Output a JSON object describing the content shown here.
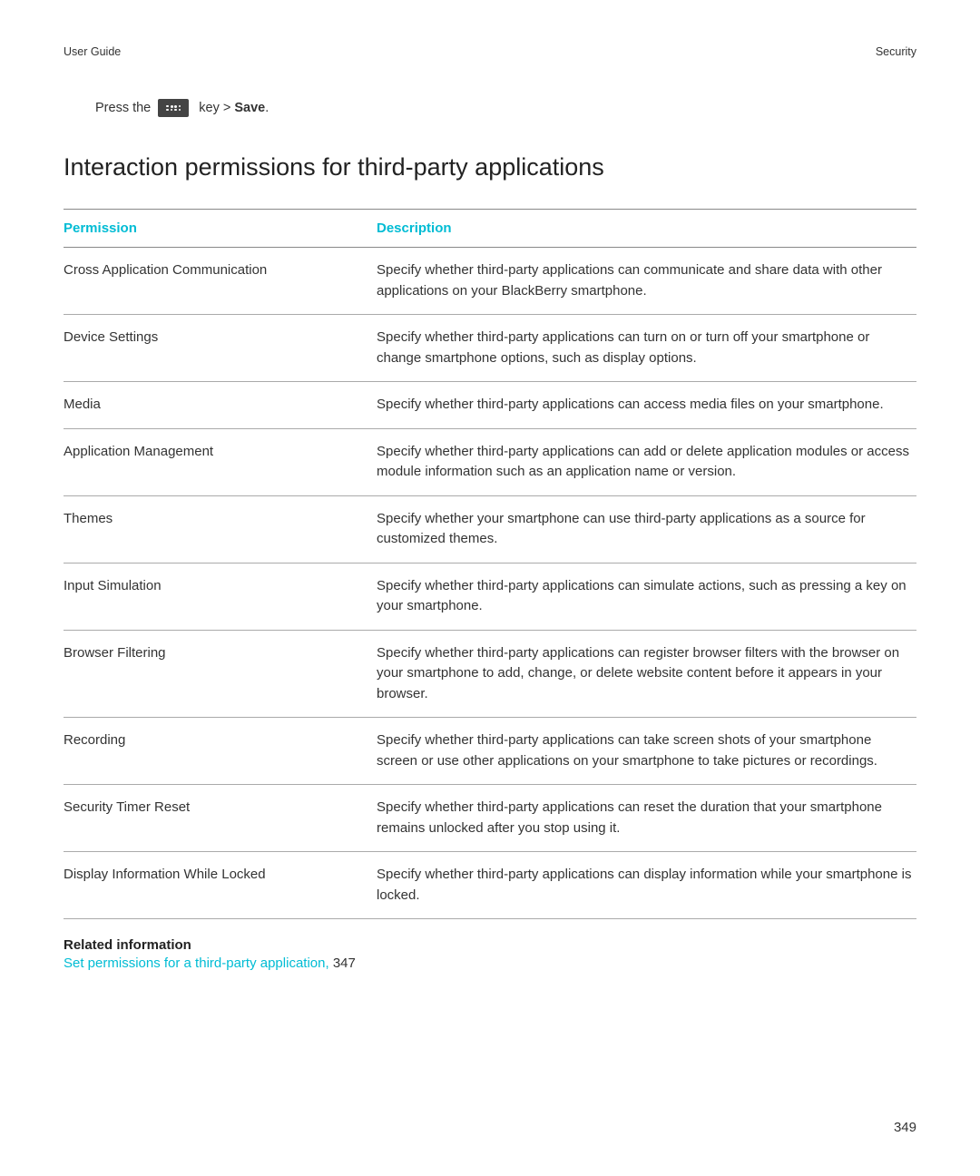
{
  "header": {
    "left": "User Guide",
    "right": "Security"
  },
  "pressLine": {
    "before": "Press the",
    "afterKey": "key >",
    "save": "Save",
    "period": "."
  },
  "title": "Interaction permissions for third-party applications",
  "table": {
    "headers": {
      "permission": "Permission",
      "description": "Description"
    },
    "rows": [
      {
        "permission": "Cross Application Communication",
        "description": "Specify whether third-party applications can communicate and share data with other applications on your BlackBerry smartphone."
      },
      {
        "permission": "Device Settings",
        "description": "Specify whether third-party applications can turn on or turn off your smartphone or change smartphone options, such as display options."
      },
      {
        "permission": "Media",
        "description": "Specify whether third-party applications can access media files on your smartphone."
      },
      {
        "permission": "Application Management",
        "description": "Specify whether third-party applications can add or delete application modules or access module information such as an application name or version."
      },
      {
        "permission": "Themes",
        "description": "Specify whether your smartphone can use third-party applications as a source for customized themes."
      },
      {
        "permission": "Input Simulation",
        "description": "Specify whether third-party applications can simulate actions, such as pressing a key on your smartphone."
      },
      {
        "permission": "Browser Filtering",
        "description": "Specify whether third-party applications can register browser filters with the browser on your smartphone to add, change, or delete website content before it appears in your browser."
      },
      {
        "permission": "Recording",
        "description": "Specify whether third-party applications can take screen shots of your smartphone screen or use other applications on your smartphone to take pictures or recordings."
      },
      {
        "permission": "Security Timer Reset",
        "description": "Specify whether third-party applications can reset the duration that your smartphone remains unlocked after you stop using it."
      },
      {
        "permission": "Display Information While Locked",
        "description": "Specify whether third-party applications can display information while your smartphone is locked."
      }
    ]
  },
  "related": {
    "heading": "Related information",
    "linkText": "Set permissions for a third-party application, ",
    "pageRef": "347"
  },
  "pageNumber": "349"
}
